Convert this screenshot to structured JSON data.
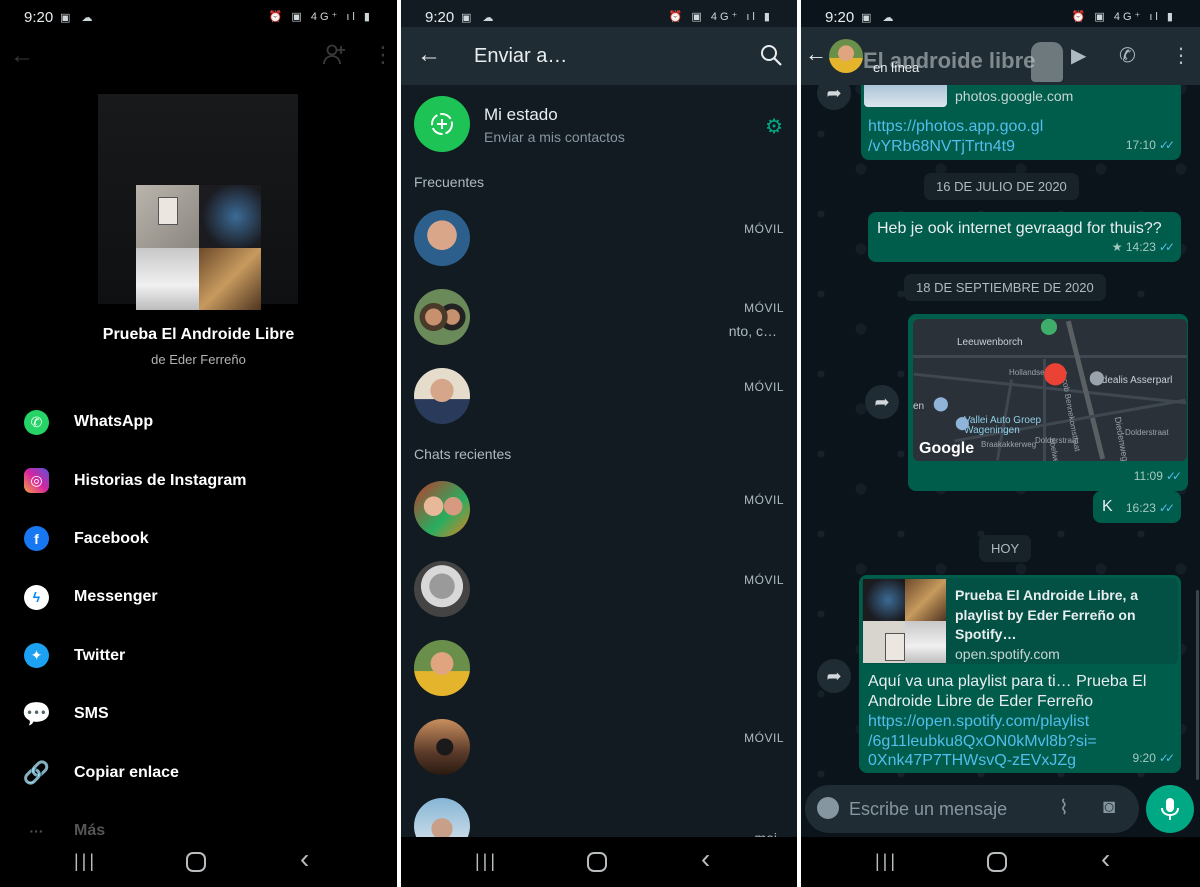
{
  "status_bar": {
    "time": "9:20",
    "left_icons": "▣ ☁",
    "right_icons": "⏰ ▣ 4G⁺ ıl ▮"
  },
  "spotify_share": {
    "playlist_title": "Prueba El Androide Libre",
    "playlist_owner": "de Eder Ferreño",
    "icons": {
      "back": "←",
      "add_person": "add-person-icon",
      "more": "⋮"
    },
    "targets": [
      {
        "label": "WhatsApp",
        "icon": "whatsapp-icon",
        "glyph": "✆"
      },
      {
        "label": "Historias de Instagram",
        "icon": "instagram-icon",
        "glyph": "◎"
      },
      {
        "label": "Facebook",
        "icon": "facebook-icon",
        "glyph": "f"
      },
      {
        "label": "Messenger",
        "icon": "messenger-icon",
        "glyph": "ϟ"
      },
      {
        "label": "Twitter",
        "icon": "twitter-icon",
        "glyph": "✦"
      },
      {
        "label": "SMS",
        "icon": "sms-icon",
        "glyph": "💬"
      },
      {
        "label": "Copiar enlace",
        "icon": "link-icon",
        "glyph": "🔗"
      },
      {
        "label": "Más",
        "icon": "more-icon",
        "glyph": "···"
      }
    ]
  },
  "send_to": {
    "title": "Enviar a…",
    "my_status": {
      "name": "Mi estado",
      "subtitle": "Enviar a mis contactos"
    },
    "section_frequent": "Frecuentes",
    "section_recent": "Chats recientes",
    "frequent": [
      {
        "tag": "MÓVIL",
        "snippet": ""
      },
      {
        "tag": "MÓVIL",
        "snippet": "nto, c…"
      },
      {
        "tag": "MÓVIL",
        "snippet": ""
      }
    ],
    "recent": [
      {
        "tag": "MÓVIL",
        "snippet": ""
      },
      {
        "tag": "MÓVIL",
        "snippet": ""
      },
      {
        "tag": "",
        "snippet": ""
      },
      {
        "tag": "MÓVIL",
        "snippet": ""
      },
      {
        "tag": "",
        "snippet": "mei"
      }
    ]
  },
  "chat": {
    "header_watermark": "El androide libre",
    "contact_status": "en línea",
    "msg_photos": {
      "domain": "photos.google.com",
      "url_line1": "https://photos.app.goo.gl",
      "url_line2": "/vYRb68NVTjTrtn4t9",
      "time": "17:10"
    },
    "date_1": "16 DE JULIO DE 2020",
    "msg_internet": {
      "text": "Heb je ook internet gevraagd for thuis??",
      "time": "14:23",
      "starred": "★"
    },
    "date_2": "18 DE SEPTIEMBRE DE 2020",
    "msg_map": {
      "time": "11:09",
      "places": [
        "Leeuwenborch",
        "Hollandse",
        "Idealis Asserparl",
        "Vallei Auto Groep",
        "Wageningen",
        "Diedenweg",
        "Braakakkerweg",
        "Dolderstraat",
        "Dolderstraat",
        "Jacob Bennekomstraat",
        "en",
        "bbelweg"
      ],
      "brand": "Google"
    },
    "msg_k": {
      "text": "K",
      "time": "16:23"
    },
    "date_3": "HOY",
    "msg_spotify": {
      "preview_title": "Prueba El Androide Libre, a playlist by Eder Ferreño on Spotify…",
      "preview_domain": "open.spotify.com",
      "text": "Aquí va una playlist para ti… Prueba El Androide Libre de Eder Ferreño",
      "url_line1": "https://open.spotify.com/playlist",
      "url_line2": "/6g11leubku8QxON0kMvl8b?si=",
      "url_line3": "0Xnk47P7THWsvQ-zEVxJZg",
      "time": "9:20"
    },
    "input_placeholder": "Escribe un mensaje"
  },
  "colors": {
    "wa_green": "#00a884",
    "outgoing_bubble": "#005c4b",
    "header": "#1f2c33",
    "link": "#53bdeb"
  }
}
